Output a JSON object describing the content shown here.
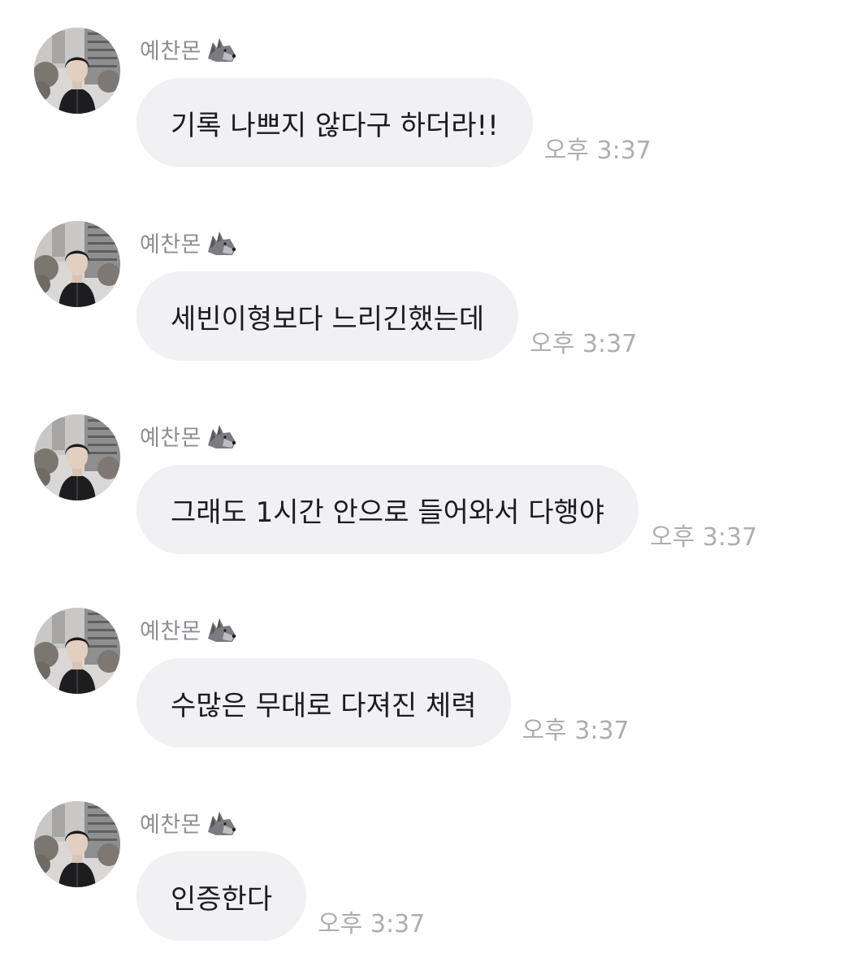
{
  "sender_name": "예찬몬",
  "sender_icon": "wolf-icon",
  "colors": {
    "bubble": "#f1f1f3",
    "text": "#1c1c1e",
    "meta": "#8e8e93",
    "time": "#aeaeb2"
  },
  "messages": [
    {
      "text": "기록 나쁘지 않다구 하더라!!",
      "time": "오후 3:37"
    },
    {
      "text": "세빈이형보다 느리긴했는데",
      "time": "오후 3:37"
    },
    {
      "text": "그래도 1시간 안으로 들어와서 다행야",
      "time": "오후 3:37"
    },
    {
      "text": "수많은 무대로 다져진 체력",
      "time": "오후 3:37"
    },
    {
      "text": "인증한다",
      "time": "오후 3:37"
    }
  ]
}
